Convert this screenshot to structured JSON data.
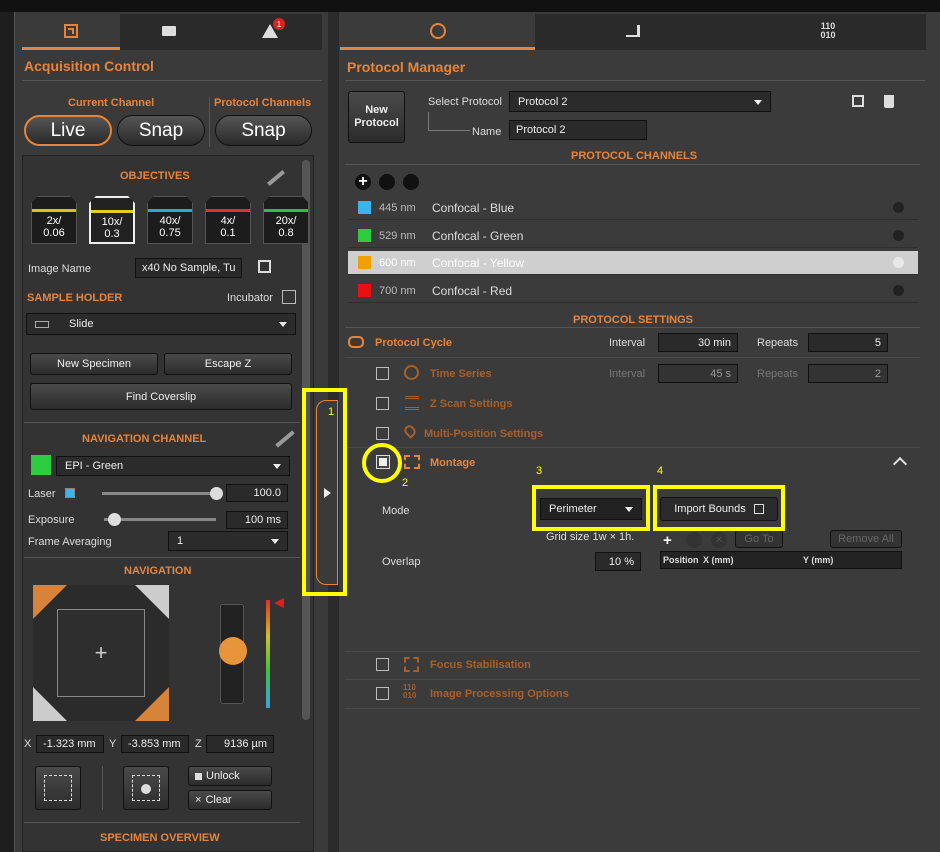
{
  "left": {
    "title": "Acquisition Control",
    "current_channel_label": "Current Channel",
    "protocol_channels_label": "Protocol Channels",
    "live_label": "Live",
    "snap_label": "Snap",
    "snap2_label": "Snap",
    "objectives_title": "OBJECTIVES",
    "objectives": [
      {
        "mag": "2x/",
        "na": "0.06",
        "color": "#e0c020"
      },
      {
        "mag": "10x/",
        "na": "0.3",
        "color": "#e0d020"
      },
      {
        "mag": "40x/",
        "na": "0.75",
        "color": "#2aa8d8"
      },
      {
        "mag": "4x/",
        "na": "0.1",
        "color": "#e03030"
      },
      {
        "mag": "20x/",
        "na": "0.8",
        "color": "#30c040"
      }
    ],
    "image_name_label": "Image Name",
    "image_name_value": "x40 No Sample, Tu",
    "sample_holder_title": "SAMPLE HOLDER",
    "incubator_label": "Incubator",
    "sample_holder_value": "Slide",
    "new_specimen_label": "New Specimen",
    "escape_z_label": "Escape Z",
    "find_coverslip_label": "Find Coverslip",
    "nav_channel_title": "NAVIGATION CHANNEL",
    "nav_channel_value": "EPI - Green",
    "laser_label": "Laser",
    "laser_value": "100.0",
    "laser_level": 1.0,
    "exposure_label": "Exposure",
    "exposure_value": "100 ms",
    "exposure_level": 0.05,
    "frame_avg_label": "Frame Averaging",
    "frame_avg_value": "1",
    "navigation_title": "NAVIGATION",
    "x_label": "X",
    "x_value": "-1.323 mm",
    "y_label": "Y",
    "y_value": "-3.853 mm",
    "z_label": "Z",
    "z_value": "9136 µm",
    "unlock_label": "Unlock",
    "clear_label": "Clear",
    "specimen_overview_title": "SPECIMEN OVERVIEW"
  },
  "right": {
    "title": "Protocol Manager",
    "new_protocol_label": "New Protocol",
    "select_protocol_label": "Select Protocol",
    "select_protocol_value": "Protocol 2",
    "name_label": "Name",
    "name_value": "Protocol 2",
    "protocol_channels_title": "PROTOCOL CHANNELS",
    "channels": [
      {
        "wl": "445 nm",
        "name": "Confocal - Blue",
        "color": "#3cb4e8"
      },
      {
        "wl": "529 nm",
        "name": "Confocal - Green",
        "color": "#2ecc40"
      },
      {
        "wl": "600 nm",
        "name": "Confocal - Yellow",
        "color": "#f0a000"
      },
      {
        "wl": "700 nm",
        "name": "Confocal - Red",
        "color": "#e81010"
      }
    ],
    "protocol_settings_title": "PROTOCOL SETTINGS",
    "protocol_cycle_label": "Protocol Cycle",
    "interval_label": "Interval",
    "interval_value": "30 min",
    "repeats_label": "Repeats",
    "repeats_value": "5",
    "time_series_label": "Time Series",
    "ts_interval_label": "Interval",
    "ts_interval_value": "45 s",
    "ts_repeats_label": "Repeats",
    "ts_repeats_value": "2",
    "z_scan_label": "Z Scan Settings",
    "multi_position_label": "Multi-Position Settings",
    "montage_label": "Montage",
    "mode_label": "Mode",
    "mode_value": "Perimeter",
    "import_bounds_label": "Import Bounds",
    "grid_size_text": "Grid size 1w × 1h.",
    "go_to_label": "Go To",
    "remove_all_label": "Remove All",
    "position_col": "Position",
    "x_col": "X (mm)",
    "y_col": "Y (mm)",
    "overlap_label": "Overlap",
    "overlap_value": "10 %",
    "focus_stab_label": "Focus Stabilisation",
    "image_proc_label": "Image Processing Options"
  },
  "annotations": [
    "1",
    "2",
    "3",
    "4"
  ]
}
